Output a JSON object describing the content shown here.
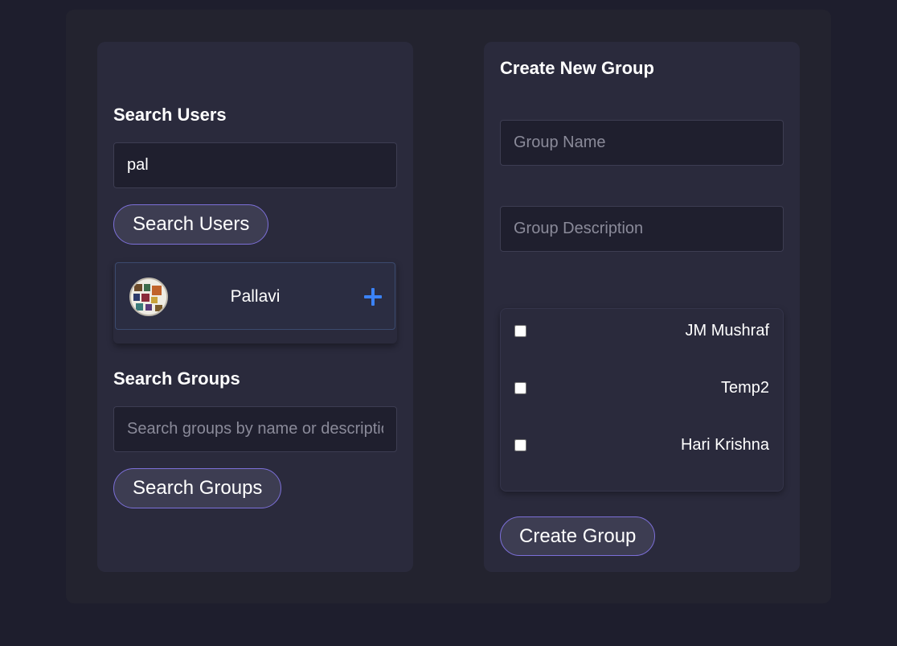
{
  "search_users": {
    "heading": "Search Users",
    "input_value": "pal",
    "button_label": "Search Users",
    "results": [
      {
        "name": "Pallavi",
        "add_icon": "plus-icon"
      }
    ]
  },
  "search_groups": {
    "heading": "Search Groups",
    "placeholder": "Search groups by name or description",
    "button_label": "Search Groups"
  },
  "create_group": {
    "heading": "Create New Group",
    "name_placeholder": "Group Name",
    "description_placeholder": "Group Description",
    "members": [
      {
        "name": "JM Mushraf",
        "checked": false
      },
      {
        "name": "Temp2",
        "checked": false
      },
      {
        "name": "Hari Krishna",
        "checked": false
      }
    ],
    "button_label": "Create Group"
  },
  "colors": {
    "background": "#1e1e2d",
    "panel": "#2a2a3c",
    "accent_border": "#7c6fd8",
    "add_icon": "#3b82f6"
  }
}
